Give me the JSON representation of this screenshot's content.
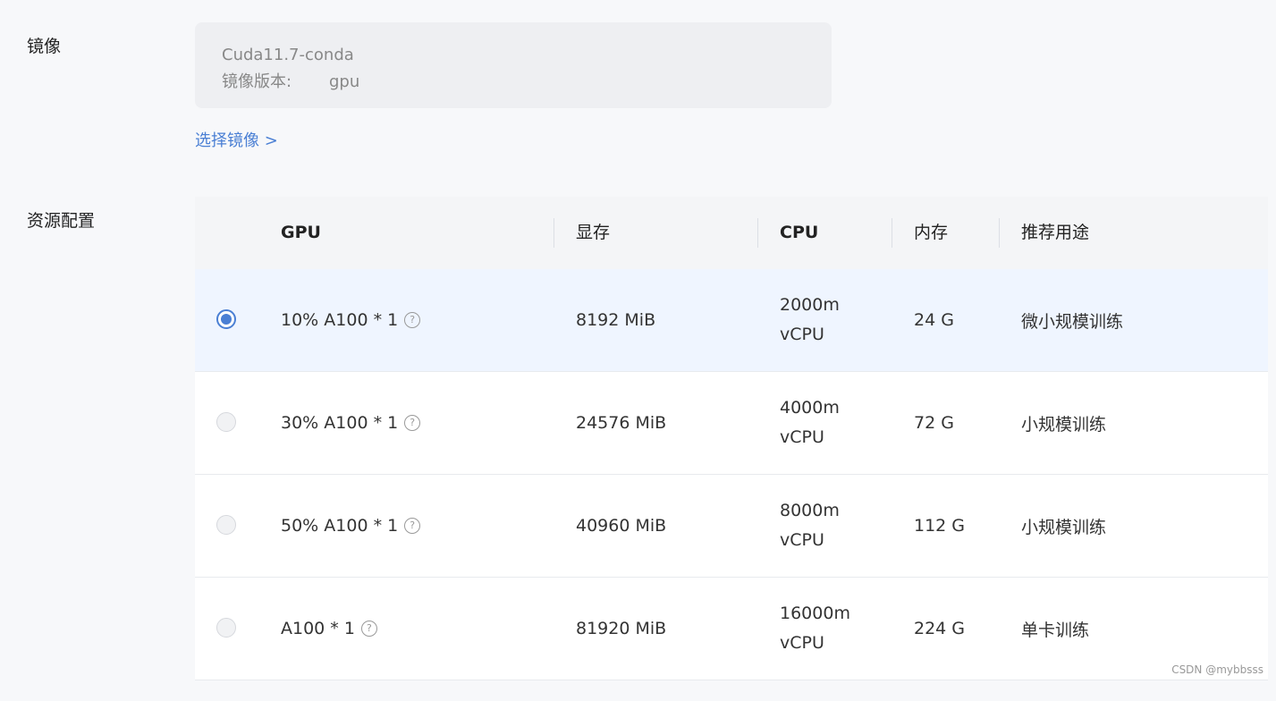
{
  "image_section": {
    "label": "镜像",
    "image_name": "Cuda11.7-conda",
    "version_label": "镜像版本:",
    "version_value": "gpu",
    "select_link": "选择镜像 >"
  },
  "resource_section": {
    "label": "资源配置",
    "columns": [
      "GPU",
      "显存",
      "CPU",
      "内存",
      "推荐用途"
    ],
    "rows": [
      {
        "gpu": "10% A100 * 1",
        "vram": "8192 MiB",
        "cpu_line1": "2000m",
        "cpu_line2": "vCPU",
        "mem": "24 G",
        "usage": "微小规模训练",
        "selected": true,
        "help": "?"
      },
      {
        "gpu": "30% A100 * 1",
        "vram": "24576 MiB",
        "cpu_line1": "4000m",
        "cpu_line2": "vCPU",
        "mem": "72 G",
        "usage": "小规模训练",
        "selected": false,
        "help": "?"
      },
      {
        "gpu": "50% A100 * 1",
        "vram": "40960 MiB",
        "cpu_line1": "8000m",
        "cpu_line2": "vCPU",
        "mem": "112 G",
        "usage": "小规模训练",
        "selected": false,
        "help": "?"
      },
      {
        "gpu": "A100 * 1",
        "vram": "81920 MiB",
        "cpu_line1": "16000m",
        "cpu_line2": "vCPU",
        "mem": "224 G",
        "usage": "单卡训练",
        "selected": false,
        "help": "?"
      }
    ]
  },
  "colors": {
    "accent": "#4a7fd4",
    "selected_row": "#eff5ff"
  },
  "watermark": "CSDN @mybbsss"
}
